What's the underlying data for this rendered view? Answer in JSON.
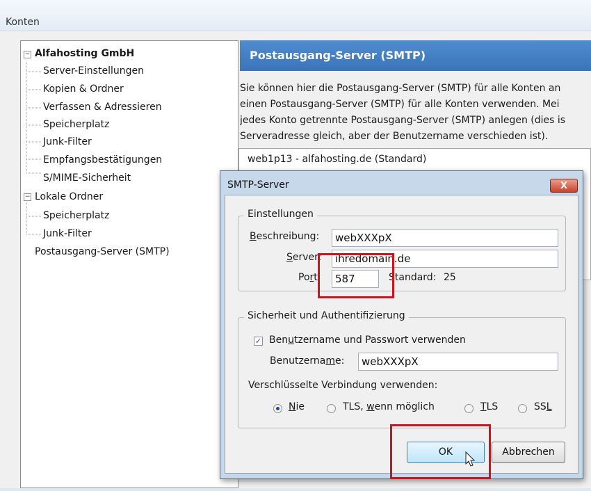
{
  "window": {
    "title": "Konten"
  },
  "tree": {
    "items": [
      {
        "label": "Alfahosting GmbH",
        "level": 0,
        "expander": "minus",
        "bold": true
      },
      {
        "label": "Server-Einstellungen",
        "level": 1
      },
      {
        "label": "Kopien & Ordner",
        "level": 1
      },
      {
        "label": "Verfassen & Adressieren",
        "level": 1
      },
      {
        "label": "Speicherplatz",
        "level": 1
      },
      {
        "label": "Junk-Filter",
        "level": 1
      },
      {
        "label": "Empfangsbestätigungen",
        "level": 1
      },
      {
        "label": "S/MIME-Sicherheit",
        "level": 1
      },
      {
        "label": "Lokale Ordner",
        "level": 0,
        "expander": "minus"
      },
      {
        "label": "Speicherplatz",
        "level": 1
      },
      {
        "label": "Junk-Filter",
        "level": 1
      },
      {
        "label": "Postausgang-Server (SMTP)",
        "level": 0
      }
    ]
  },
  "panel": {
    "header": "Postausgang-Server (SMTP)",
    "description": [
      "Sie können hier die Postausgang-Server (SMTP) für alle Konten an",
      "einen Postausgang-Server (SMTP) für alle Konten verwenden. Mei",
      "jedes Konto getrennte Postausgang-Server (SMTP) anlegen (dies is",
      "Serveradresse gleich, aber der Benutzername verschieden ist)."
    ],
    "server_item": "web1p13 - alfahosting.de (Standard)"
  },
  "dialog": {
    "title": "SMTP-Server",
    "close_glyph": "X",
    "settings": {
      "legend": "Einstellungen",
      "description_label": "Beschreibung:",
      "description_value": "webXXXpX",
      "server_label": "Server:",
      "server_value": "ihredomain.de",
      "port_label": "Port:",
      "port_value": "587",
      "default_label": "Standard:",
      "default_value": "25"
    },
    "security": {
      "legend": "Sicherheit und Authentifizierung",
      "use_auth_label": "Benutzername und Passwort verwenden",
      "use_auth_checked": true,
      "username_label": "Benutzername:",
      "username_value": "webXXXpX",
      "encryption_label": "Verschlüsselte Verbindung verwenden:",
      "options": [
        "Nie",
        "TLS, wenn möglich",
        "TLS",
        "SSL"
      ],
      "selected": "Nie"
    },
    "ok_label": "OK",
    "cancel_label": "Abbrechen"
  },
  "colors": {
    "header": "#3b74b9",
    "highlight": "#d1111c"
  }
}
